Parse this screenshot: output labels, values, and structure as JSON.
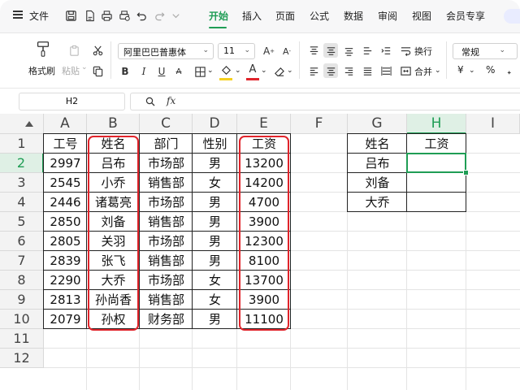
{
  "menubar": {
    "file_label": "文件",
    "tabs": [
      "开始",
      "插入",
      "页面",
      "公式",
      "数据",
      "审阅",
      "视图",
      "会员专享"
    ],
    "active_tab": "开始"
  },
  "toolbar": {
    "format_painter": "格式刷",
    "paste": "粘贴",
    "font_name": "阿里巴巴普惠体",
    "font_size": "11",
    "bold": "B",
    "italic": "I",
    "underline": "U",
    "wrap": "换行",
    "merge": "合并",
    "number_format": "常规",
    "currency": "¥",
    "percent": "%",
    "font_color": "#e0242b",
    "fill_color": "#f5d020"
  },
  "formula": {
    "cell_ref": "H2",
    "fx": "fx",
    "content": ""
  },
  "sheet": {
    "columns": [
      "A",
      "B",
      "C",
      "D",
      "E",
      "F",
      "G",
      "H",
      "I"
    ],
    "active_column": "H",
    "rows": [
      "1",
      "2",
      "3",
      "4",
      "5",
      "6",
      "7",
      "8",
      "9",
      "10",
      "11",
      "12"
    ],
    "active_row": "2",
    "employees": {
      "headers": [
        "工号",
        "姓名",
        "部门",
        "性别",
        "工资"
      ],
      "rows": [
        [
          "2997",
          "吕布",
          "市场部",
          "男",
          "13200"
        ],
        [
          "2545",
          "小乔",
          "销售部",
          "女",
          "14200"
        ],
        [
          "2446",
          "诸葛亮",
          "市场部",
          "男",
          "4700"
        ],
        [
          "2850",
          "刘备",
          "销售部",
          "男",
          "3900"
        ],
        [
          "2805",
          "关羽",
          "市场部",
          "男",
          "12300"
        ],
        [
          "2839",
          "张飞",
          "销售部",
          "男",
          "8100"
        ],
        [
          "2290",
          "大乔",
          "市场部",
          "女",
          "13700"
        ],
        [
          "2813",
          "孙尚香",
          "销售部",
          "女",
          "3900"
        ],
        [
          "2079",
          "孙权",
          "财务部",
          "男",
          "11100"
        ]
      ]
    },
    "lookup": {
      "headers": [
        "姓名",
        "工资"
      ],
      "rows": [
        [
          "吕布",
          ""
        ],
        [
          "刘备",
          ""
        ],
        [
          "大乔",
          ""
        ]
      ]
    }
  }
}
